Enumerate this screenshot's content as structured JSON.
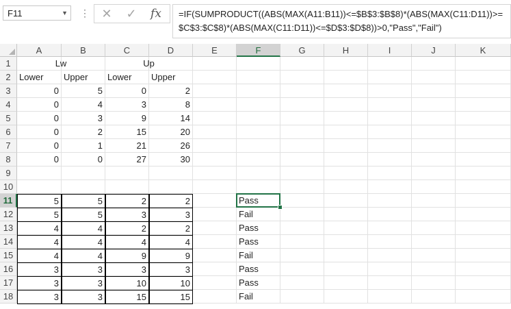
{
  "namebox": "F11",
  "formula": "=IF(SUMPRODUCT((ABS(MAX(A11:B11))<=$B$3:$B$8)*(ABS(MAX(C11:D11))>=$C$3:$C$8)*(ABS(MAX(C11:D11))<=$D$3:$D$8))>0,\"Pass\",\"Fail\")",
  "columns": [
    "A",
    "B",
    "C",
    "D",
    "E",
    "F",
    "G",
    "H",
    "I",
    "J",
    "K"
  ],
  "rows": [
    "1",
    "2",
    "3",
    "4",
    "5",
    "6",
    "7",
    "8",
    "9",
    "10",
    "11",
    "12",
    "13",
    "14",
    "15",
    "16",
    "17",
    "18"
  ],
  "selected_column": "F",
  "selected_row": "11",
  "headers": {
    "lw": "Lw",
    "up": "Up",
    "a2": "Lower",
    "b2": "Upper",
    "c2": "Lower",
    "d2": "Upper"
  },
  "table1": [
    [
      "0",
      "5",
      "0",
      "2"
    ],
    [
      "0",
      "4",
      "3",
      "8"
    ],
    [
      "0",
      "3",
      "9",
      "14"
    ],
    [
      "0",
      "2",
      "15",
      "20"
    ],
    [
      "0",
      "1",
      "21",
      "26"
    ],
    [
      "0",
      "0",
      "27",
      "30"
    ]
  ],
  "table2": [
    [
      "5",
      "5",
      "2",
      "2"
    ],
    [
      "5",
      "5",
      "3",
      "3"
    ],
    [
      "4",
      "4",
      "2",
      "2"
    ],
    [
      "4",
      "4",
      "4",
      "4"
    ],
    [
      "4",
      "4",
      "9",
      "9"
    ],
    [
      "3",
      "3",
      "3",
      "3"
    ],
    [
      "3",
      "3",
      "10",
      "10"
    ],
    [
      "3",
      "3",
      "15",
      "15"
    ]
  ],
  "results": [
    "Pass",
    "Fail",
    "Pass",
    "Pass",
    "Fail",
    "Pass",
    "Pass",
    "Fail"
  ]
}
